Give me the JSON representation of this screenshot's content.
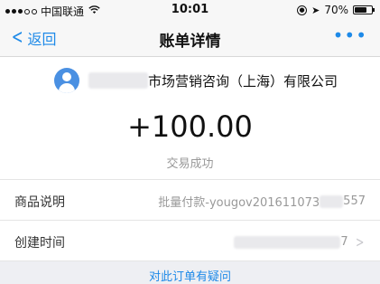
{
  "status_bar": {
    "carrier": "中国联通",
    "time": "10:01",
    "battery": "70%",
    "battery_level": 0.7
  },
  "nav": {
    "back_label": "返回",
    "title": "账单详情",
    "more_label": "•••"
  },
  "merchant": {
    "name": "市场营销咨询（上海）有限公司"
  },
  "transaction": {
    "amount": "+100.00",
    "status": "交易成功"
  },
  "details": [
    {
      "label": "商品说明",
      "value_prefix": "批量付款-yougov201611073",
      "value_suffix": "557"
    },
    {
      "label": "创建时间",
      "value_suffix": "7"
    }
  ],
  "footer": {
    "question_link": "对此订单有疑问"
  },
  "colors": {
    "accent": "#1e8ae8",
    "avatar": "#4a90e2",
    "background": "#eeeff3"
  }
}
